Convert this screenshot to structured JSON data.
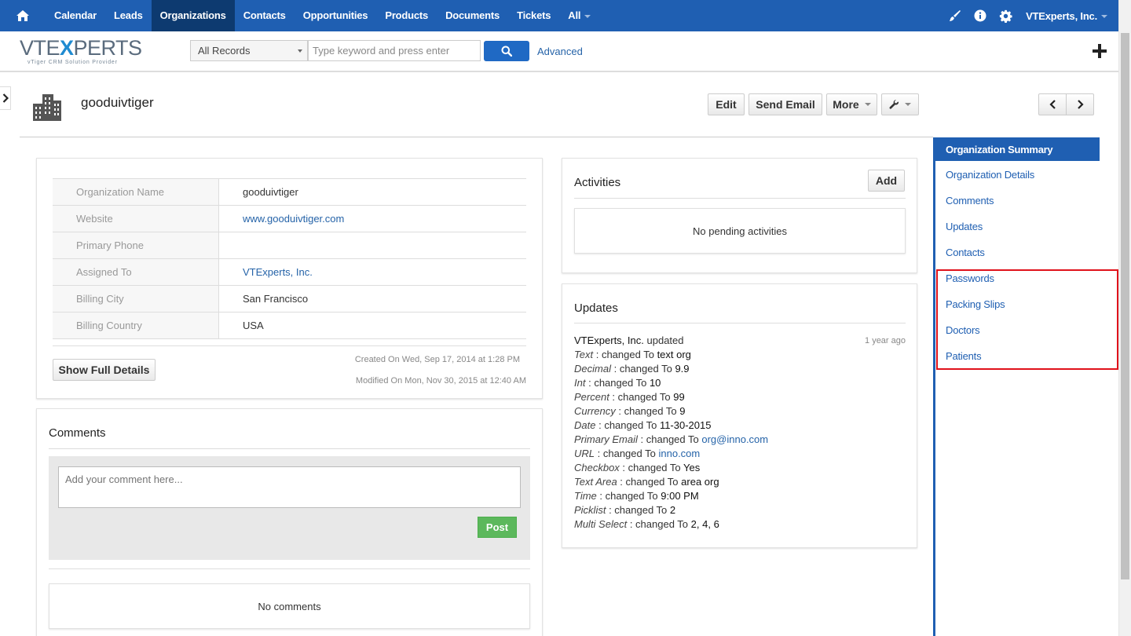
{
  "topnav": {
    "items": [
      "Calendar",
      "Leads",
      "Organizations",
      "Contacts",
      "Opportunities",
      "Products",
      "Documents",
      "Tickets",
      "All"
    ],
    "active": "Organizations",
    "user": "VTExperts, Inc.",
    "icons": [
      "home-icon",
      "brush-icon",
      "info-icon",
      "gear-icon"
    ]
  },
  "searchbar": {
    "logo_main": "VTEXPERTS",
    "logo_sub": "vTiger CRM Solution Provider",
    "records_select": "All Records",
    "search_placeholder": "Type keyword and press enter",
    "advanced_label": "Advanced"
  },
  "record": {
    "title": "gooduivtiger",
    "buttons": {
      "edit": "Edit",
      "send_email": "Send Email",
      "more": "More"
    }
  },
  "summary": {
    "fields": [
      {
        "label": "Organization Name",
        "value": "gooduivtiger",
        "link": false
      },
      {
        "label": "Website",
        "value": "www.gooduivtiger.com",
        "link": true
      },
      {
        "label": "Primary Phone",
        "value": "",
        "link": false
      },
      {
        "label": "Assigned To",
        "value": "VTExperts, Inc.",
        "link": true
      },
      {
        "label": "Billing City",
        "value": "San Francisco",
        "link": false
      },
      {
        "label": "Billing Country",
        "value": "USA",
        "link": false
      }
    ],
    "show_full_details": "Show Full Details",
    "created_on": "Created On Wed, Sep 17, 2014 at 1:28 PM",
    "modified_on": "Modified On Mon, Nov 30, 2015 at 12:40 AM"
  },
  "comments": {
    "title": "Comments",
    "placeholder": "Add your comment here...",
    "post_label": "Post",
    "empty_text": "No comments"
  },
  "activities": {
    "title": "Activities",
    "add_label": "Add",
    "empty_text": "No pending activities"
  },
  "updates": {
    "title": "Updates",
    "author": "VTExperts, Inc.",
    "action": "updated",
    "time_ago": "1 year ago",
    "changed_to": "changed To",
    "changes": [
      {
        "field": "Text",
        "value": "text org",
        "link": false
      },
      {
        "field": "Decimal",
        "value": "9.9",
        "link": false
      },
      {
        "field": "Int",
        "value": "10",
        "link": false
      },
      {
        "field": "Percent",
        "value": "99",
        "link": false
      },
      {
        "field": "Currency",
        "value": "9",
        "link": false
      },
      {
        "field": "Date",
        "value": "11-30-2015",
        "link": false
      },
      {
        "field": "Primary Email",
        "value": "org@inno.com",
        "link": true
      },
      {
        "field": "URL",
        "value": "inno.com",
        "link": true
      },
      {
        "field": "Checkbox",
        "value": "Yes",
        "link": false
      },
      {
        "field": "Text Area",
        "value": "area org",
        "link": false
      },
      {
        "field": "Time",
        "value": "9:00 PM",
        "link": false
      },
      {
        "field": "Picklist",
        "value": "2",
        "link": false
      },
      {
        "field": "Multi Select",
        "value": "2, 4, 6",
        "link": false
      }
    ]
  },
  "rightnav": {
    "active": "Organization Summary",
    "items": [
      "Organization Details",
      "Comments",
      "Updates",
      "Contacts",
      "Passwords",
      "Packing Slips",
      "Doctors",
      "Patients"
    ]
  },
  "colors": {
    "nav_blue": "#1f5fb2",
    "nav_active": "#0d3a70",
    "link": "#2563a8",
    "post_green": "#5cb85c",
    "highlight_red": "#e0121b"
  }
}
